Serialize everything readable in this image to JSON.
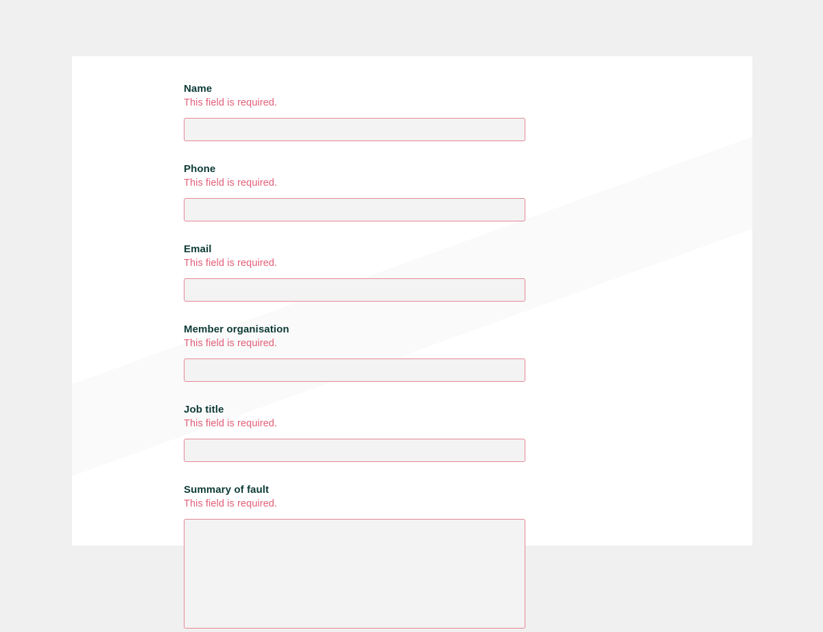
{
  "form": {
    "fields": {
      "name": {
        "label": "Name",
        "error": "This field is required.",
        "value": ""
      },
      "phone": {
        "label": "Phone",
        "error": "This field is required.",
        "value": ""
      },
      "email": {
        "label": "Email",
        "error": "This field is required.",
        "value": ""
      },
      "org": {
        "label": "Member organisation",
        "error": "This field is required.",
        "value": ""
      },
      "job": {
        "label": "Job title",
        "error": "This field is required.",
        "value": ""
      },
      "fault": {
        "label": "Summary of fault",
        "error": "This field is required.",
        "value": ""
      }
    }
  },
  "colors": {
    "page_bg": "#f0f0f0",
    "card_bg": "#ffffff",
    "label": "#0c3a36",
    "error": "#e35d77",
    "input_bg": "#f3f3f3",
    "input_border_error": "#e48593"
  }
}
